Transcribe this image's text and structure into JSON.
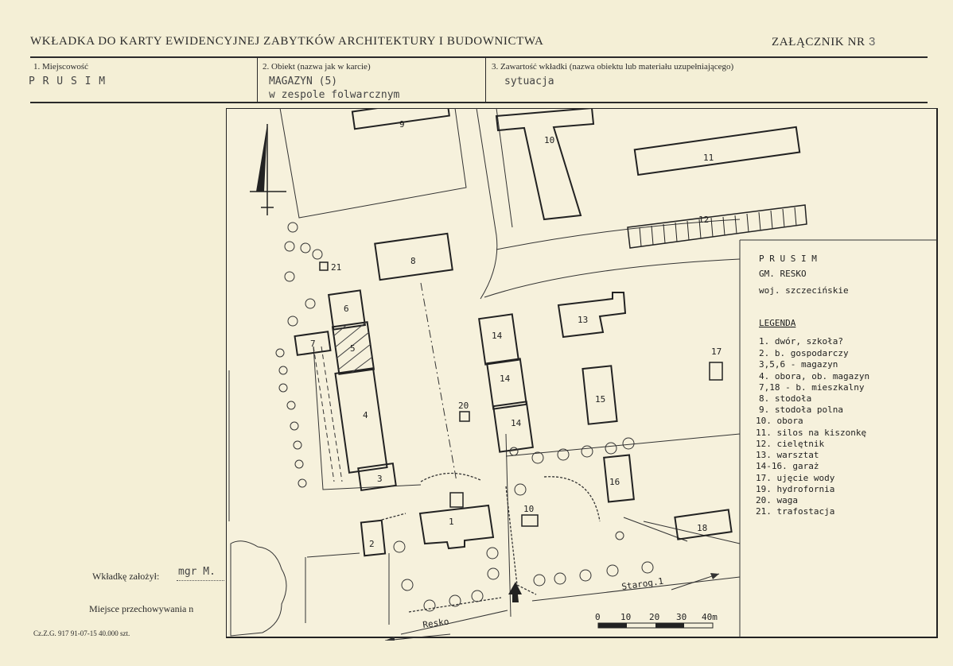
{
  "header": {
    "title": "WKŁADKA DO KARTY EWIDENCYJNEJ ZABYTKÓW ARCHITEKTURY I BUDOWNICTWA",
    "attachment_label": "ZAŁĄCZNIK NR",
    "attachment_number": "3"
  },
  "fields": {
    "locality": {
      "label": "1. Miejscowość",
      "value": "P R U S I M"
    },
    "object": {
      "label": "2. Obiekt (nazwa jak w karcie)",
      "value_line1": "MAGAZYN (5)",
      "value_line2": "w zespole folwarcznym"
    },
    "content": {
      "label": "3. Zawartość wkładki (nazwa obiektu lub materiału uzupełniającego)",
      "value": "sytuacja"
    }
  },
  "footer": {
    "established_label": "Wkładkę założył:",
    "established_value": "mgr M.",
    "storage_label": "Miejsce przechowywania n",
    "print_info": "Cz.Z.G. 917 91-07-15 40.000 szt."
  },
  "map": {
    "place": "P R U S I M",
    "commune": "GM. RESKO",
    "voivodeship": "woj. szczecińskie",
    "legend_title": "LEGENDA",
    "legend": [
      "1. dwór, szkoła?",
      "2. b. gospodarczy",
      "3,5,6 - magazyn",
      "4. obora, ob. magazyn",
      "7,18 - b. mieszkalny",
      "8. stodoła",
      "9. stodoła polna",
      "10. obora",
      "11. silos na kiszonkę",
      "12. cielętnik",
      "13. warsztat",
      "14-16. garaż",
      "17. ujęcie wody",
      "19. hydrofornia",
      "20. waga",
      "21. trafostacja"
    ],
    "roads": {
      "south": "Resko",
      "east": "Starog.1"
    },
    "scale_labels": [
      "0",
      "10",
      "20",
      "30",
      "40m"
    ],
    "labels": {
      "b1": "1",
      "b2": "2",
      "b3": "3",
      "b4": "4",
      "b5": "5",
      "b6": "6",
      "b7": "7",
      "b8": "8",
      "b9": "9",
      "b10": "10",
      "b10b": "10",
      "b11": "11",
      "b12": "12",
      "b13": "13",
      "b14a": "14",
      "b14b": "14",
      "b14c": "14",
      "b15": "15",
      "b16": "16",
      "b17": "17",
      "b18": "18",
      "b20": "20",
      "b21": "21"
    }
  }
}
